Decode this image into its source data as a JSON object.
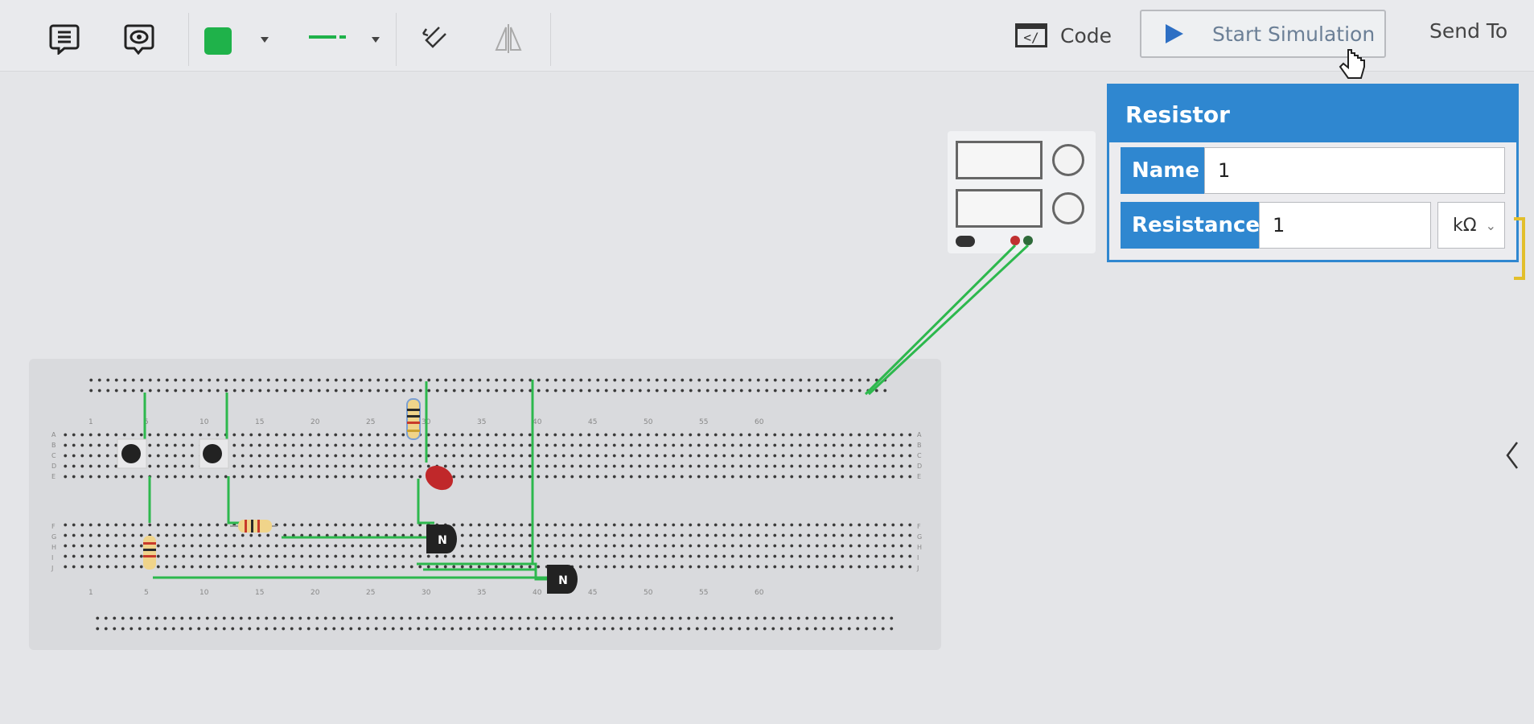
{
  "toolbar": {
    "code_label": "Code",
    "code_icon": "code-window-icon",
    "start_simulation_label": "Start Simulation",
    "send_to_label": "Send To",
    "wire_color": "#1fb24a"
  },
  "inspector": {
    "title": "Resistor",
    "name_label": "Name",
    "name_value": "1",
    "resistance_label": "Resistance",
    "resistance_value": "1",
    "unit_value": "kΩ"
  },
  "breadboard": {
    "column_numbers": [
      "1",
      "5",
      "10",
      "15",
      "20",
      "25",
      "30",
      "35",
      "40",
      "45",
      "50",
      "55",
      "60"
    ],
    "row_letters": [
      "A",
      "B",
      "C",
      "D",
      "E",
      "F",
      "G",
      "H",
      "I",
      "J"
    ]
  },
  "colors": {
    "accent": "#2f87d0",
    "wire": "#2db84d",
    "led": "#c0282a"
  }
}
